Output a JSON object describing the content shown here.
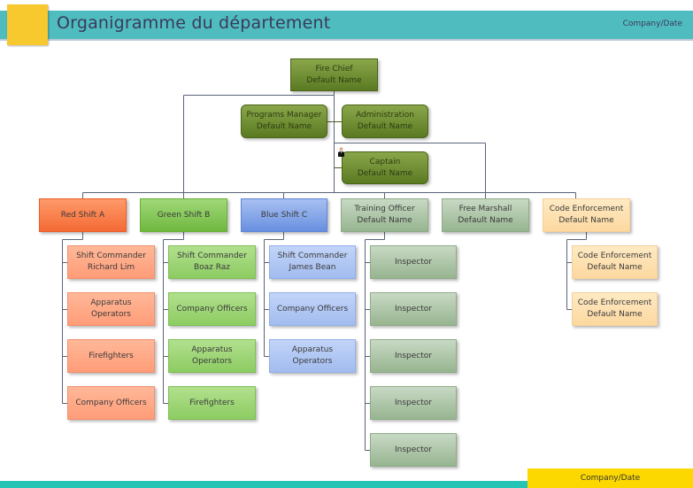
{
  "header": {
    "title": "Organigramme du département",
    "company_date": "Company/Date"
  },
  "footer": {
    "company_date": "Company/Date"
  },
  "colors": {
    "header_teal": "#4fbcbf",
    "header_yellow": "#f8c92e",
    "footer_teal": "#26c4b4",
    "footer_yellow": "#fdd800"
  },
  "org": {
    "fire_chief": {
      "title": "Fire Chief",
      "name": "Default Name"
    },
    "programs_manager": {
      "title": "Programs Manager",
      "name": "Default Name"
    },
    "administration": {
      "title": "Administration",
      "name": "Default Name"
    },
    "captain": {
      "title": "Captain",
      "name": "Default Name",
      "icon": "person-icon"
    },
    "departments": [
      {
        "title": "Red Shift A"
      },
      {
        "title": "Green Shift B"
      },
      {
        "title": "Blue Shift C"
      },
      {
        "title": "Training Officer",
        "name": "Default Name"
      },
      {
        "title": "Free Marshall",
        "name": "Default Name"
      },
      {
        "title": "Code Enforcement",
        "name": "Default Name"
      }
    ],
    "red_shift": [
      {
        "line1": "Shift Commander",
        "line2": "Richard Lim"
      },
      {
        "line1": "Apparatus",
        "line2": "Operators"
      },
      {
        "line1": "Firefighters"
      },
      {
        "line1": "Company Officers"
      }
    ],
    "green_shift": [
      {
        "line1": "Shift Commander",
        "line2": "Boaz Raz"
      },
      {
        "line1": "Company Officers"
      },
      {
        "line1": "Apparatus",
        "line2": "Operators"
      },
      {
        "line1": "Firefighters"
      }
    ],
    "blue_shift": [
      {
        "line1": "Shift Commander",
        "line2": "James Bean"
      },
      {
        "line1": "Company Officers"
      },
      {
        "line1": "Apparatus",
        "line2": "Operators"
      }
    ],
    "training": [
      {
        "line1": "Inspector"
      },
      {
        "line1": "Inspector"
      },
      {
        "line1": "Inspector"
      },
      {
        "line1": "Inspector"
      },
      {
        "line1": "Inspector"
      }
    ],
    "code_enforcement": [
      {
        "line1": "Code Enforcement",
        "line2": "Default Name"
      },
      {
        "line1": "Code Enforcement",
        "line2": "Default Name"
      }
    ]
  }
}
